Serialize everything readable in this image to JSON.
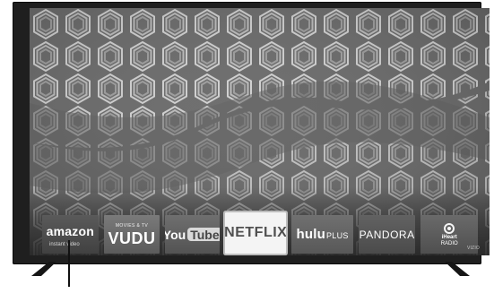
{
  "apps": {
    "amazon": {
      "brand": "amazon",
      "subtitle": "instant video"
    },
    "vudu": {
      "top": "MOVIES & TV",
      "main": "VUDU"
    },
    "youtube": {
      "you": "You",
      "tube": "Tube"
    },
    "netflix": {
      "label": "NETFLIX"
    },
    "hulu": {
      "main": "hulu",
      "plus": "PLUS"
    },
    "pandora": {
      "label": "PANDORA"
    },
    "iheart": {
      "line1": "iHeart",
      "line2": "RADIO"
    }
  },
  "brand": {
    "tv_mark": "VIZIO"
  }
}
